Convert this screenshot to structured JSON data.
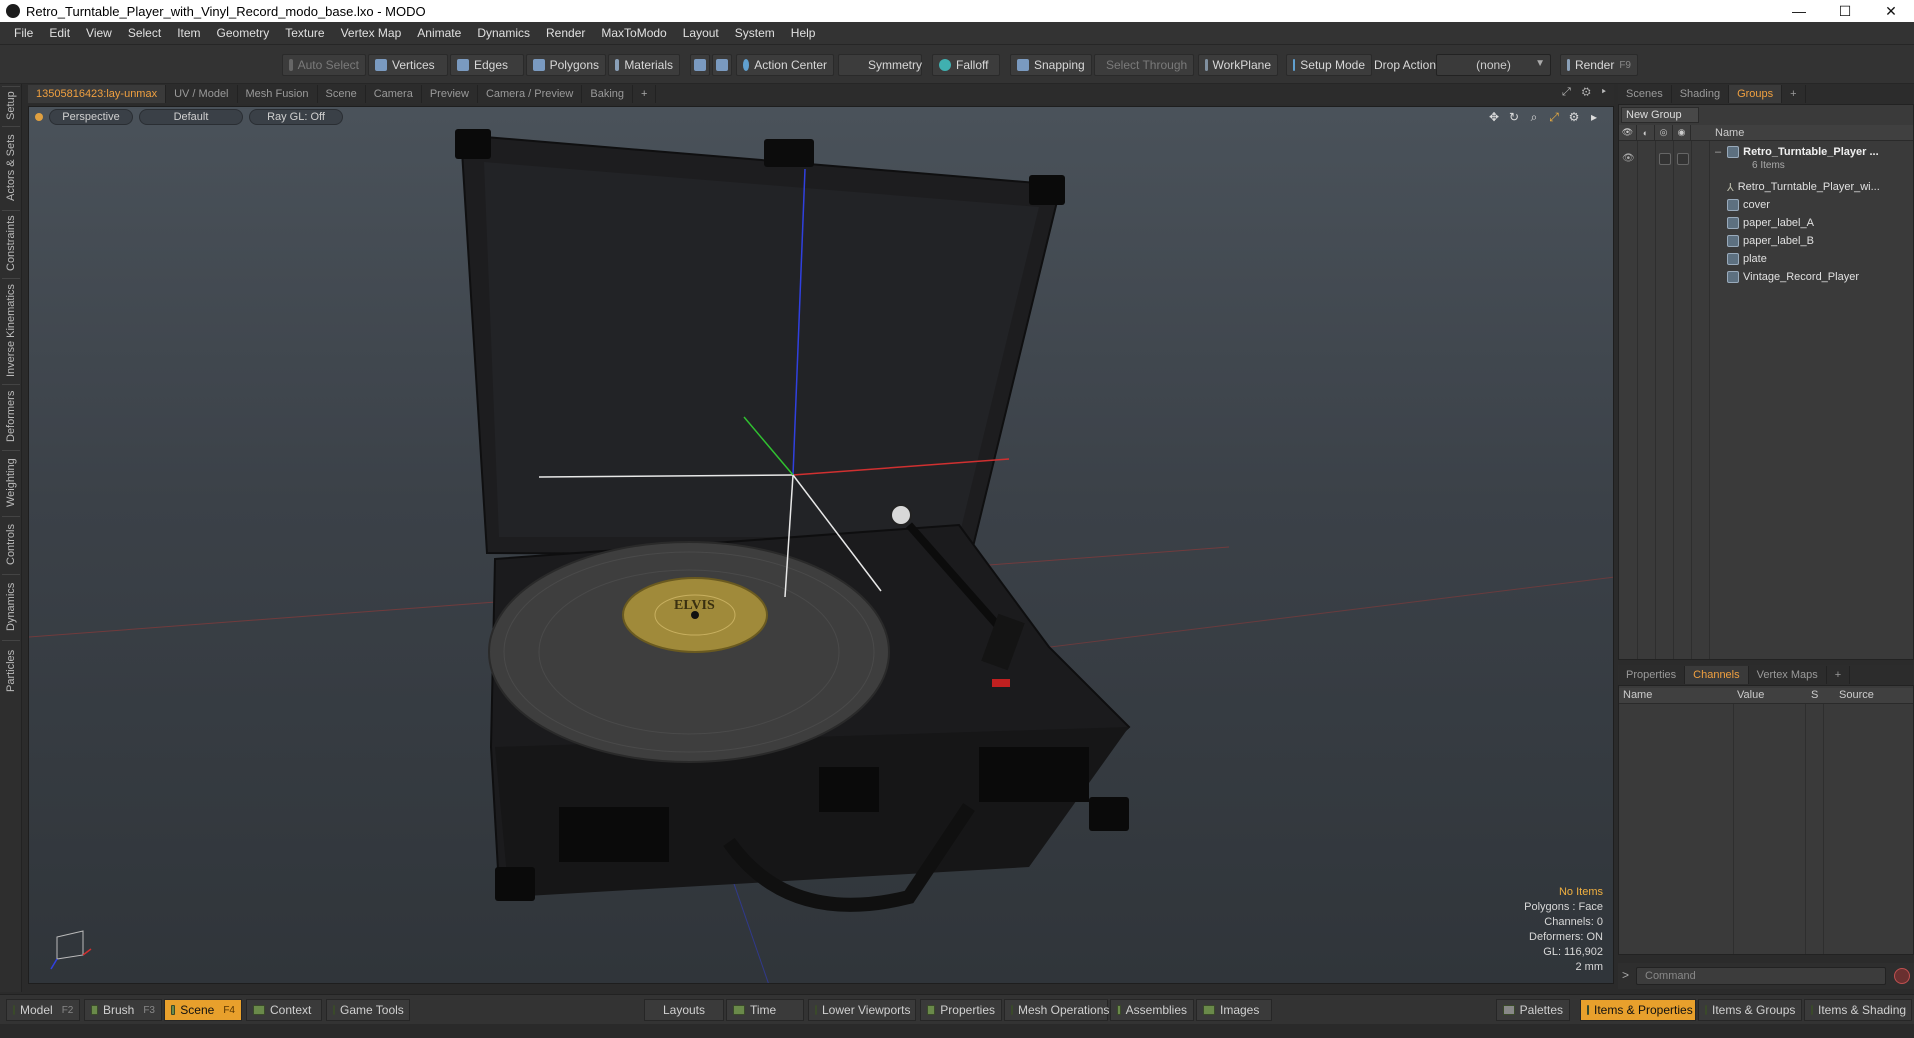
{
  "window": {
    "title": "Retro_Turntable_Player_with_Vinyl_Record_modo_base.lxo - MODO",
    "controls": [
      "—",
      "☐",
      "✕"
    ]
  },
  "menu": [
    "File",
    "Edit",
    "View",
    "Select",
    "Item",
    "Geometry",
    "Texture",
    "Vertex Map",
    "Animate",
    "Dynamics",
    "Render",
    "MaxToModo",
    "Layout",
    "System",
    "Help"
  ],
  "toolbar": {
    "auto_select": "Auto Select",
    "vertices": "Vertices",
    "edges": "Edges",
    "polygons": "Polygons",
    "materials": "Materials",
    "action_center": "Action Center",
    "symmetry": "Symmetry",
    "falloff": "Falloff",
    "snapping": "Snapping",
    "select_through": "Select Through",
    "workplane": "WorkPlane",
    "setup_mode": "Setup Mode",
    "drop_action_label": "Drop Action",
    "drop_action_value": "(none)",
    "render": "Render",
    "render_key": "F9"
  },
  "left_tabs": [
    "Setup",
    "Actors & Sets",
    "Constraints",
    "Inverse Kinematics",
    "Deformers",
    "Weighting",
    "Controls",
    "Dynamics",
    "Particles"
  ],
  "viewport_tabs": [
    "13505816423:lay-unmax",
    "UV / Model",
    "Mesh Fusion",
    "Scene",
    "Camera",
    "Preview",
    "Camera / Preview",
    "Baking",
    "+"
  ],
  "viewport": {
    "projection": "Perspective",
    "shading": "Default",
    "raygl": "Ray GL: Off",
    "nav_icons": [
      "move-icon",
      "rotate-icon",
      "zoom-icon",
      "fit-icon",
      "settings-icon",
      "more-icon"
    ],
    "label_text": "ELVIS",
    "info": {
      "selection": "No Items",
      "polygons": "Polygons : Face",
      "channels": "Channels: 0",
      "deformers": "Deformers: ON",
      "gl": "GL: 116,902",
      "units": "2 mm"
    }
  },
  "right_tabs": [
    "Scenes",
    "Shading",
    "Groups",
    "+"
  ],
  "groups": {
    "new_group": "New Group",
    "name_header": "Name",
    "root": "Retro_Turntable_Player ...",
    "root_count": "6 Items",
    "items": [
      "Retro_Turntable_Player_wi...",
      "cover",
      "paper_label_A",
      "paper_label_B",
      "plate",
      "Vintage_Record_Player"
    ]
  },
  "channel_tabs": [
    "Properties",
    "Channels",
    "Vertex Maps",
    "+"
  ],
  "channels": {
    "headers": [
      "Name",
      "Value",
      "S",
      "Source"
    ]
  },
  "command": {
    "prompt": ">",
    "placeholder": "Command"
  },
  "bottombar": {
    "model": "Model",
    "model_key": "F2",
    "brush": "Brush",
    "brush_key": "F3",
    "scene": "Scene",
    "scene_key": "F4",
    "context": "Context",
    "game_tools": "Game Tools",
    "layouts": "Layouts",
    "time": "Time",
    "lower_viewports": "Lower Viewports",
    "properties": "Properties",
    "mesh_operations": "Mesh Operations",
    "assemblies": "Assemblies",
    "images": "Images",
    "palettes": "Palettes",
    "items_properties": "Items & Properties",
    "items_groups": "Items & Groups",
    "items_shading": "Items & Shading"
  },
  "colors": {
    "accent": "#e8a02c",
    "axis_x": "#d03030",
    "axis_y": "#30c030",
    "axis_z": "#3040e0"
  }
}
